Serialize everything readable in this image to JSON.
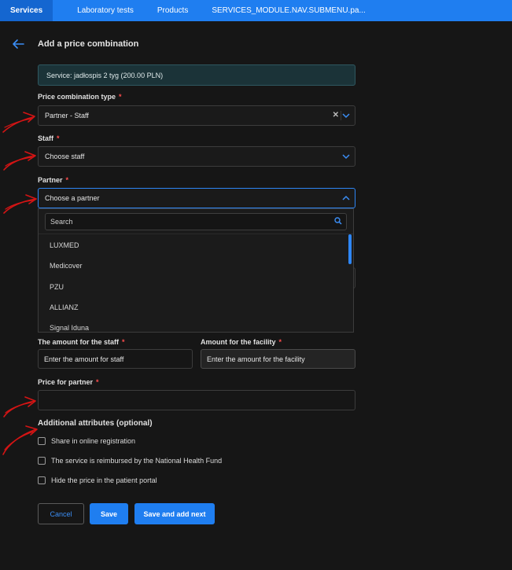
{
  "nav": {
    "tabs": [
      "Services",
      "Laboratory tests",
      "Products",
      "SERVICES_MODULE.NAV.SUBMENU.pa..."
    ]
  },
  "page": {
    "title": "Add a price combination",
    "service": "Service: jadłospis 2 tyg (200.00 PLN)"
  },
  "form": {
    "price_type": {
      "label": "Price combination type",
      "required": "*",
      "value": "Partner - Staff"
    },
    "staff": {
      "label": "Staff",
      "required": "*",
      "value": "Choose staff"
    },
    "partner": {
      "label": "Partner",
      "required": "*",
      "value": "Choose a partner",
      "search_placeholder": "Search",
      "options": [
        "LUXMED",
        "Medicover",
        "PZU",
        "ALLIANZ",
        "Signal Iduna"
      ]
    },
    "amount_staff": {
      "label": "The amount for the staff",
      "required": "*",
      "placeholder": "Enter the amount for staff"
    },
    "amount_facility": {
      "label": "Amount for the facility",
      "required": "*",
      "placeholder": "Enter the amount for the facility"
    },
    "price_partner": {
      "label": "Price for partner",
      "required": "*",
      "value": ""
    }
  },
  "additional": {
    "title": "Additional attributes (optional)",
    "options": [
      "Share in online registration",
      "The service is reimbursed by the National Health Fund",
      "Hide the price in the patient portal"
    ]
  },
  "actions": {
    "cancel": "Cancel",
    "save": "Save",
    "save_next": "Save and add next"
  },
  "colors": {
    "accent": "#1f7ef0",
    "required": "#ff4d4d",
    "annotation": "#d41414"
  },
  "icons": [
    "back-arrow-icon",
    "chevron-down-icon",
    "chevron-up-icon",
    "clear-icon",
    "search-icon",
    "checkbox-icon"
  ]
}
